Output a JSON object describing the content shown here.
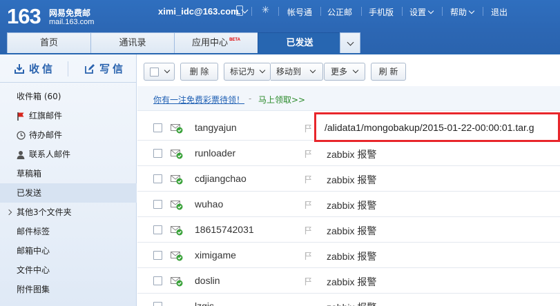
{
  "header": {
    "logo_number": "163",
    "logo_name": "网易免费邮",
    "logo_url": "mail.163.com",
    "account": "ximi_idc@163.com",
    "links": [
      "帐号通",
      "公正邮",
      "手机版",
      "设置",
      "帮助",
      "退出"
    ]
  },
  "tabs": [
    {
      "label": "首页"
    },
    {
      "label": "通讯录"
    },
    {
      "label": "应用中心",
      "badge": "BETA"
    },
    {
      "label": "已发送",
      "active": true
    }
  ],
  "sidebar": {
    "receive_label": "收信",
    "compose_label": "写信",
    "folders": [
      {
        "label": "收件箱 (60)",
        "icon": ""
      },
      {
        "label": "红旗邮件",
        "icon": "red-flag-icon"
      },
      {
        "label": "待办邮件",
        "icon": "clock-icon"
      },
      {
        "label": "联系人邮件",
        "icon": "contact-icon"
      },
      {
        "label": "草稿箱",
        "icon": ""
      },
      {
        "label": "已发送",
        "icon": "",
        "active": true
      },
      {
        "label": "其他3个文件夹",
        "icon": "chevron-right-icon"
      },
      {
        "label": "邮件标签",
        "icon": ""
      },
      {
        "label": "邮箱中心",
        "icon": ""
      },
      {
        "label": "文件中心",
        "icon": ""
      },
      {
        "label": "附件图集",
        "icon": ""
      }
    ]
  },
  "toolbar": {
    "delete": "删 除",
    "mark_as": "标记为",
    "move_to": "移动到",
    "more": "更多",
    "refresh": "刷 新"
  },
  "promo": {
    "link": "你有一注免费彩票待领！",
    "separator": "-",
    "action": "马上领取>>"
  },
  "mails": [
    {
      "from": "tangyajun",
      "subject": "/alidata1/mongobakup/2015-01-22-00:00:01.tar.g"
    },
    {
      "from": "runloader",
      "subject": "zabbix 报警"
    },
    {
      "from": "cdjiangchao",
      "subject": "zabbix 报警"
    },
    {
      "from": "wuhao",
      "subject": "zabbix 报警"
    },
    {
      "from": "18615742031",
      "subject": "zabbix 报警"
    },
    {
      "from": "ximigame",
      "subject": "zabbix 报警"
    },
    {
      "from": "doslin",
      "subject": "zabbix 报警"
    },
    {
      "from": "lzgjs",
      "subject": "zabbix 报警"
    }
  ],
  "colors": {
    "brand_blue": "#2766b1",
    "highlight_red": "#e8262b",
    "sent_check_green": "#3aa23a"
  }
}
